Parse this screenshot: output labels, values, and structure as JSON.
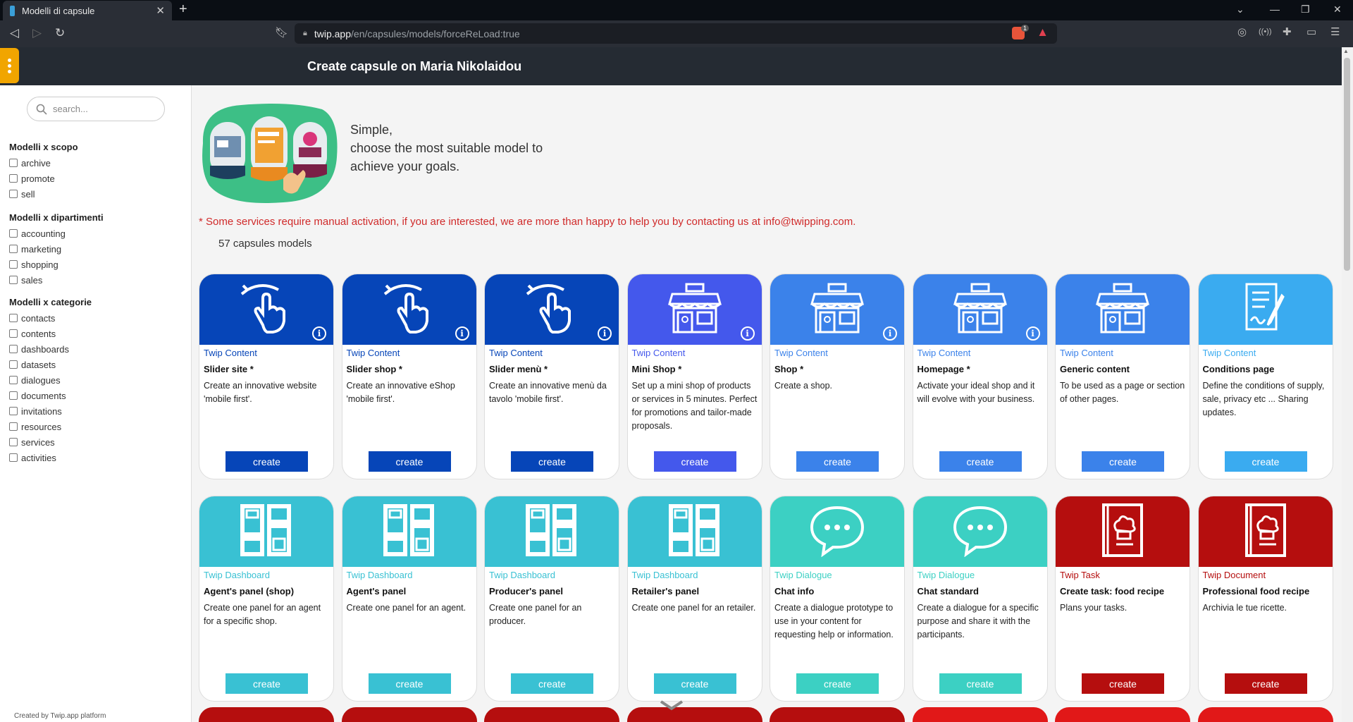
{
  "browser": {
    "tab_title": "Modelli di capsule",
    "url_host": "twip.app",
    "url_path": "/en/capsules/models/forceReLoad:true",
    "brave_badge": "1"
  },
  "app": {
    "title": "Create capsule on Maria Nikolaidou"
  },
  "sidebar": {
    "search_placeholder": "search...",
    "groups": [
      {
        "title": "Modelli x scopo",
        "items": [
          "archive",
          "promote",
          "sell"
        ]
      },
      {
        "title": "Modelli x dipartimenti",
        "items": [
          "accounting",
          "marketing",
          "shopping",
          "sales"
        ]
      },
      {
        "title": "Modelli x categorie",
        "items": [
          "contacts",
          "contents",
          "dashboards",
          "datasets",
          "dialogues",
          "documents",
          "invitations",
          "resources",
          "services",
          "activities"
        ]
      }
    ],
    "credit": "Created by Twip.app platform"
  },
  "intro": {
    "line1": "Simple,",
    "line2": "choose the most suitable model to",
    "line3": "achieve your goals.",
    "notice": "* Some services require manual activation, if you are interested, we are more than happy to help you by contacting us at info@twipping.com.",
    "count": "57 capsules models"
  },
  "cards": [
    {
      "category": "Twip Content",
      "name": "Slider site *",
      "description": "Create an innovative website 'mobile first'.",
      "button": "create",
      "color": "#0645b8",
      "icon": "swipe-hand-icon",
      "info": true
    },
    {
      "category": "Twip Content",
      "name": "Slider shop *",
      "description": "Create an innovative eShop 'mobile first'.",
      "button": "create",
      "color": "#0645b8",
      "icon": "swipe-hand-icon",
      "info": true
    },
    {
      "category": "Twip Content",
      "name": "Slider menù *",
      "description": "Create an innovative menù da tavolo 'mobile first'.",
      "button": "create",
      "color": "#0645b8",
      "icon": "swipe-hand-icon",
      "info": true
    },
    {
      "category": "Twip Content",
      "name": "Mini Shop *",
      "description": "Set up a mini shop of products or services in 5 minutes. Perfect for promotions and tailor-made proposals.",
      "button": "create",
      "color": "#4458ec",
      "icon": "storefront-icon",
      "info": true
    },
    {
      "category": "Twip Content",
      "name": "Shop *",
      "description": "Create a shop.",
      "button": "create",
      "color": "#3b82ea",
      "icon": "storefront-icon",
      "info": true
    },
    {
      "category": "Twip Content",
      "name": "Homepage *",
      "description": "Activate your ideal shop and it will evolve with your business.",
      "button": "create",
      "color": "#3b82ea",
      "icon": "storefront-icon",
      "info": true
    },
    {
      "category": "Twip Content",
      "name": "Generic content",
      "description": "To be used as a page or section of other pages.",
      "button": "create",
      "color": "#3b82ea",
      "icon": "storefront-icon",
      "info": false
    },
    {
      "category": "Twip Content",
      "name": "Conditions page",
      "description": "Define the conditions of supply, sale, privacy etc ... Sharing updates.",
      "button": "create",
      "color": "#3aabf0",
      "icon": "contract-pen-icon",
      "info": false
    },
    {
      "category": "Twip Dashboard",
      "name": "Agent's panel (shop)",
      "description": "Create one panel for an agent for a specific shop.",
      "button": "create",
      "color": "#39c1d3",
      "icon": "dashboard-grid-icon",
      "info": false
    },
    {
      "category": "Twip Dashboard",
      "name": "Agent's panel",
      "description": "Create one panel for an agent.",
      "button": "create",
      "color": "#39c1d3",
      "icon": "dashboard-grid-icon",
      "info": false
    },
    {
      "category": "Twip Dashboard",
      "name": "Producer's panel",
      "description": "Create one panel for an producer.",
      "button": "create",
      "color": "#39c1d3",
      "icon": "dashboard-grid-icon",
      "info": false
    },
    {
      "category": "Twip Dashboard",
      "name": "Retailer's panel",
      "description": "Create one panel for an retailer.",
      "button": "create",
      "color": "#39c1d3",
      "icon": "dashboard-grid-icon",
      "info": false
    },
    {
      "category": "Twip Dialogue",
      "name": "Chat info",
      "description": "Create a dialogue prototype to use in your content for requesting help or information.",
      "button": "create",
      "color": "#3cd0c3",
      "icon": "chat-bubble-icon",
      "info": false
    },
    {
      "category": "Twip Dialogue",
      "name": "Chat standard",
      "description": "Create a dialogue for a specific purpose and share it with the participants.",
      "button": "create",
      "color": "#3cd0c3",
      "icon": "chat-bubble-icon",
      "info": false
    },
    {
      "category": "Twip Task",
      "name": "Create task: food recipe",
      "description": "Plans your tasks.",
      "button": "create",
      "color": "#b50e0e",
      "icon": "recipe-book-icon",
      "info": false
    },
    {
      "category": "Twip Document",
      "name": "Professional food recipe",
      "description": "Archivia le tue ricette.",
      "button": "create",
      "color": "#b50e0e",
      "icon": "recipe-book-icon",
      "info": false
    }
  ],
  "next_row_colors": [
    "#b50e0e",
    "#b50e0e",
    "#b50e0e",
    "#b50e0e",
    "#b50e0e",
    "#e11818",
    "#e11818",
    "#e11818"
  ]
}
